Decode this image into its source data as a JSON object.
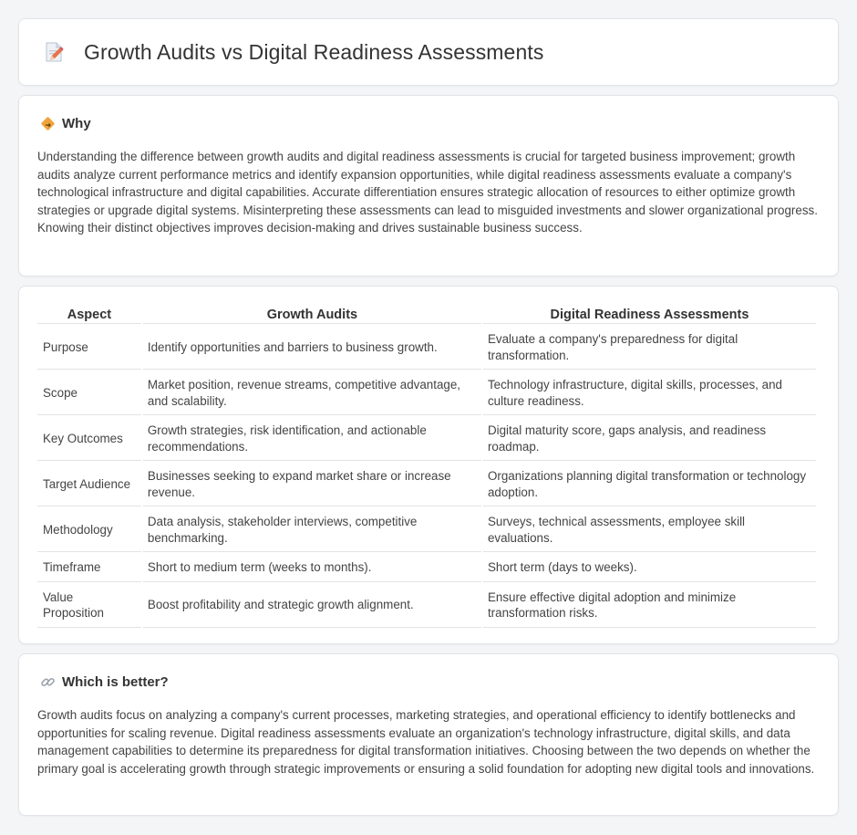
{
  "header": {
    "title": "Growth Audits vs Digital Readiness Assessments",
    "icon": "document-pencil-icon"
  },
  "why": {
    "heading": "Why",
    "icon": "diamond-sign-icon",
    "text": "Understanding the difference between growth audits and digital readiness assessments is crucial for targeted business improvement; growth audits analyze current performance metrics and identify expansion opportunities, while digital readiness assessments evaluate a company's technological infrastructure and digital capabilities. Accurate differentiation ensures strategic allocation of resources to either optimize growth strategies or upgrade digital systems. Misinterpreting these assessments can lead to misguided investments and slower organizational progress. Knowing their distinct objectives improves decision-making and drives sustainable business success."
  },
  "table": {
    "headers": [
      "Aspect",
      "Growth Audits",
      "Digital Readiness Assessments"
    ],
    "rows": [
      [
        "Purpose",
        "Identify opportunities and barriers to business growth.",
        "Evaluate a company's preparedness for digital transformation."
      ],
      [
        "Scope",
        "Market position, revenue streams, competitive advantage, and scalability.",
        "Technology infrastructure, digital skills, processes, and culture readiness."
      ],
      [
        "Key Outcomes",
        "Growth strategies, risk identification, and actionable recommendations.",
        "Digital maturity score, gaps analysis, and readiness roadmap."
      ],
      [
        "Target Audience",
        "Businesses seeking to expand market share or increase revenue.",
        "Organizations planning digital transformation or technology adoption."
      ],
      [
        "Methodology",
        "Data analysis, stakeholder interviews, competitive benchmarking.",
        "Surveys, technical assessments, employee skill evaluations."
      ],
      [
        "Timeframe",
        "Short to medium term (weeks to months).",
        "Short term (days to weeks)."
      ],
      [
        "Value Proposition",
        "Boost profitability and strategic growth alignment.",
        "Ensure effective digital adoption and minimize transformation risks."
      ]
    ]
  },
  "better": {
    "heading": "Which is better?",
    "icon": "link-icon",
    "text": "Growth audits focus on analyzing a company's current processes, marketing strategies, and operational efficiency to identify bottlenecks and opportunities for scaling revenue. Digital readiness assessments evaluate an organization's technology infrastructure, digital skills, and data management capabilities to determine its preparedness for digital transformation initiatives. Choosing between the two depends on whether the primary goal is accelerating growth through strategic improvements or ensuring a solid foundation for adopting new digital tools and innovations."
  },
  "colors": {
    "background": "#f4f5f7",
    "card": "#ffffff",
    "border": "#e1e4e8",
    "text": "#333333",
    "accent_orange": "#f0a43a"
  }
}
